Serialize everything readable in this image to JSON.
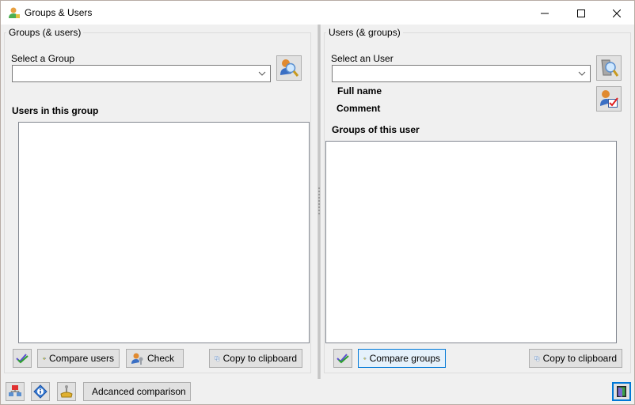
{
  "window": {
    "title": "Groups & Users",
    "controls": {
      "minimize": "minimize-icon",
      "maximize": "maximize-icon",
      "close": "close-icon"
    }
  },
  "left_panel": {
    "legend": "Groups (& users)",
    "select_label": "Select a Group",
    "select_value": "",
    "search_button_icon": "user-search-icon",
    "list_label": "Users in this group",
    "list_items": [],
    "buttons": {
      "select_all_icon": "double-check-icon",
      "compare_users": "Compare users",
      "check": "Check",
      "copy": "Copy to clipboard"
    }
  },
  "right_panel": {
    "legend": "Users (& groups)",
    "select_label": "Select an User",
    "select_value": "",
    "search_button_icon": "computer-search-icon",
    "user_check_icon": "user-check-icon",
    "full_name_label": "Full name",
    "full_name_value": "",
    "comment_label": "Comment",
    "comment_value": "",
    "list_label": "Groups of this user",
    "list_items": [],
    "buttons": {
      "select_all_icon": "double-check-icon",
      "compare_groups": "Compare groups",
      "copy": "Copy to clipboard"
    }
  },
  "bottom_bar": {
    "network_icon": "network-icon",
    "info_icon": "info-icon",
    "settings_icon": "joystick-settings-icon",
    "advanced_comparison": "Adcanced comparison",
    "exit_icon": "exit-door-icon"
  }
}
